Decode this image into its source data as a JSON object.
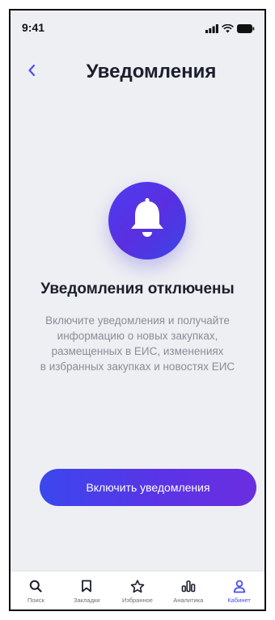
{
  "status_bar": {
    "time": "9:41"
  },
  "header": {
    "title": "Уведомления",
    "back_icon": "chevron-left-icon"
  },
  "main": {
    "icon": "bell-icon",
    "headline": "Уведомления отключены",
    "description_lines": [
      "Включите уведомления и получайте",
      "информацию о новых закупках,",
      "размещенных в ЕИС, изменениях",
      "в избранных закупках и новостях ЕИС"
    ],
    "enable_button_label": "Включить уведомления"
  },
  "tabs": [
    {
      "label": "Поиск",
      "icon": "search-icon",
      "active": false
    },
    {
      "label": "Закладки",
      "icon": "bookmark-icon",
      "active": false
    },
    {
      "label": "Избранное",
      "icon": "star-icon",
      "active": false
    },
    {
      "label": "Аналитика",
      "icon": "analytics-icon",
      "active": false
    },
    {
      "label": "Кабинет",
      "icon": "profile-icon",
      "active": true
    }
  ],
  "colors": {
    "accent": "#4b4ef0",
    "gradient_start": "#3b47ee",
    "gradient_end": "#6a2ee0",
    "background": "#eeeff3"
  }
}
